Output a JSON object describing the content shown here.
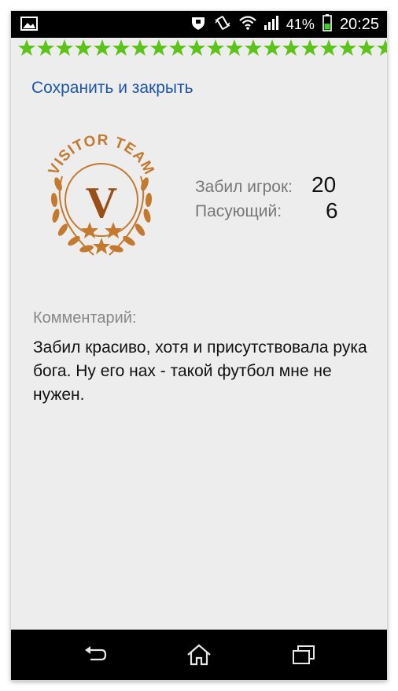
{
  "status_bar": {
    "battery_pct": "41%",
    "time": "20:25",
    "icons": [
      "gallery-icon",
      "shield-icon",
      "vibrate-icon",
      "wifi-icon",
      "signal-icon",
      "battery-icon"
    ]
  },
  "rating": {
    "stars": 20
  },
  "toolbar": {
    "save_close_label": "Сохранить и закрыть"
  },
  "team": {
    "logo_text": "VISITOR TEAM",
    "logo_letter": "V"
  },
  "stats": {
    "scorer_label": "Забил игрок:",
    "scorer_number": "20",
    "assist_label": "Пасующий:",
    "assist_number": "6"
  },
  "comment": {
    "label": "Комментарий:",
    "text": "Забил красиво, хотя и присутствовала рука бога. Ну его нах - такой футбол мне не нужен."
  },
  "colors": {
    "star": "#5cc418",
    "logo": "#c47a2e",
    "link": "#1d56a8"
  },
  "nav_bar": {
    "icons": [
      "back-icon",
      "home-icon",
      "recent-apps-icon"
    ]
  }
}
